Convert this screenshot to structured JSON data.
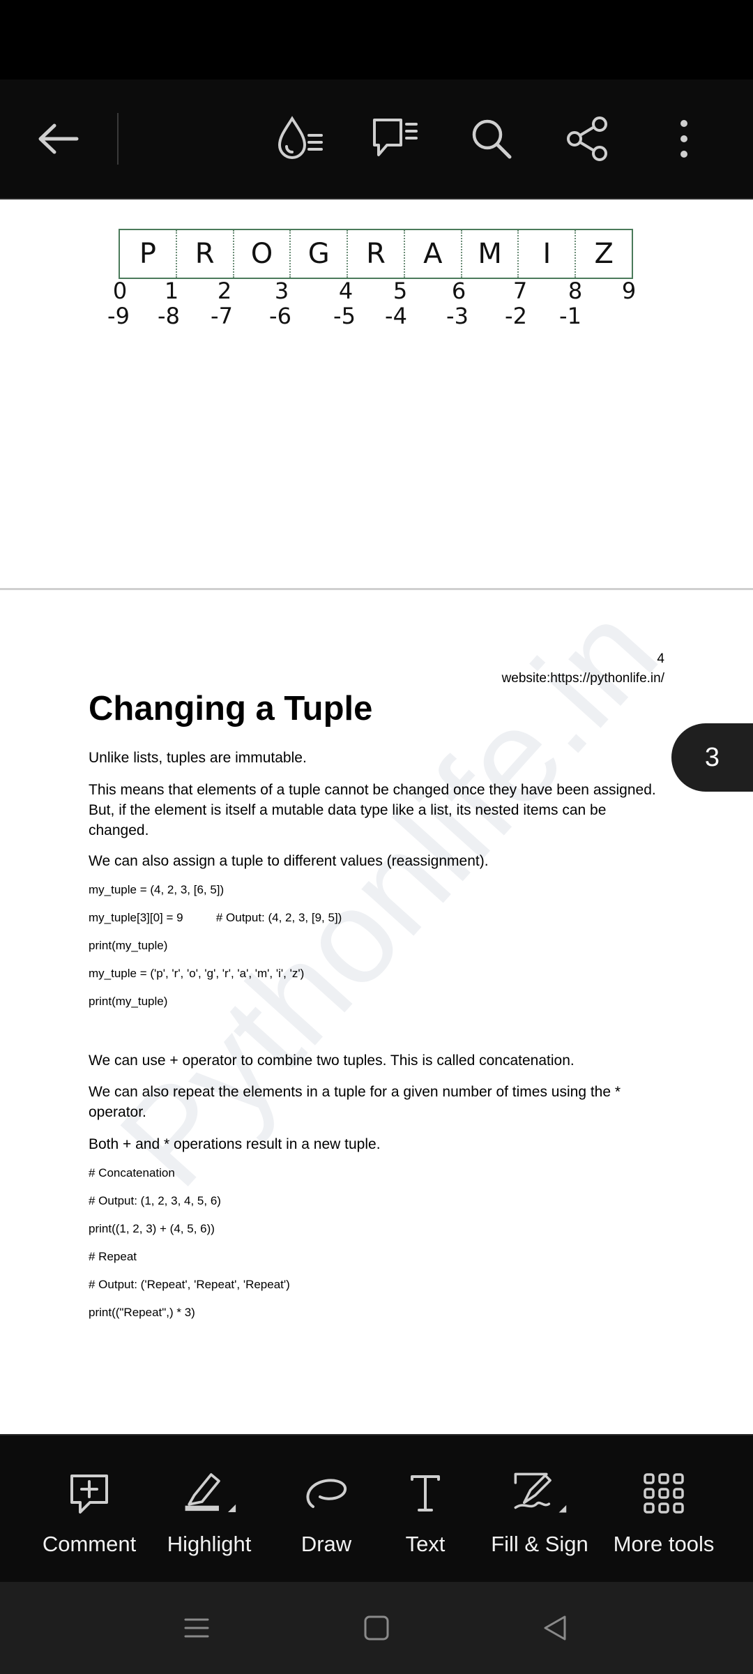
{
  "colors": {
    "toolbar_bg": "#0c0c0c",
    "icon": "#cfcfcf",
    "badge_bg": "#1f1f1f"
  },
  "toolbar": {
    "icons": [
      "back-arrow-icon",
      "liquid-mode-icon",
      "comments-list-icon",
      "search-icon",
      "share-icon",
      "more-options-icon"
    ]
  },
  "diagram": {
    "letters": [
      "P",
      "R",
      "O",
      "G",
      "R",
      "A",
      "M",
      "I",
      "Z"
    ],
    "positive_indices": [
      "0",
      "1",
      "2",
      "3",
      "4",
      "5",
      "6",
      "7",
      "8",
      "9"
    ],
    "negative_indices": [
      "-9",
      "-8",
      "-7",
      "-6",
      "-5",
      "-4",
      "-3",
      "-2",
      "-1"
    ]
  },
  "page": {
    "number": "4",
    "website": "website:https://pythonlife.in/",
    "heading": "Changing a Tuple",
    "p1": "Unlike lists, tuples are immutable.",
    "p2": "This means that elements of a tuple cannot be changed once they have been assigned. But, if the element is itself a mutable data type like a list, its nested items can be changed.",
    "p3": "We can also assign a tuple to different values (reassignment).",
    "code1": "my_tuple = (4, 2, 3, [6, 5])",
    "code2": "my_tuple[3][0] = 9          # Output: (4, 2, 3, [9, 5])",
    "code3": "print(my_tuple)",
    "code4": "my_tuple = ('p', 'r', 'o', 'g', 'r', 'a', 'm', 'i', 'z')",
    "code5": "print(my_tuple)",
    "p4": "We can use + operator to combine two tuples. This is called concatenation.",
    "p5": "We can also repeat  the elements in a tuple for a given number of times using the * operator.",
    "p6": "Both + and *  operations result in a new tuple.",
    "code6": "# Concatenation",
    "code7": "# Output: (1, 2, 3, 4, 5, 6)",
    "code8": "print((1, 2, 3) + (4, 5, 6))",
    "code9": "# Repeat",
    "code10": "# Output: ('Repeat', 'Repeat', 'Repeat')",
    "code11": "print((\"Repeat\",) * 3)",
    "watermark": "Pythonlife.in"
  },
  "page_badge": "3",
  "tools": [
    {
      "label": "Comment",
      "icon": "comment-add-icon"
    },
    {
      "label": "Highlight",
      "icon": "highlighter-icon"
    },
    {
      "label": "Draw",
      "icon": "draw-icon"
    },
    {
      "label": "Text",
      "icon": "text-icon"
    },
    {
      "label": "Fill & Sign",
      "icon": "fill-sign-icon"
    },
    {
      "label": "More tools",
      "icon": "grid-icon"
    }
  ],
  "navbar": {
    "icons": [
      "recent-apps-icon",
      "home-icon",
      "back-icon"
    ]
  }
}
